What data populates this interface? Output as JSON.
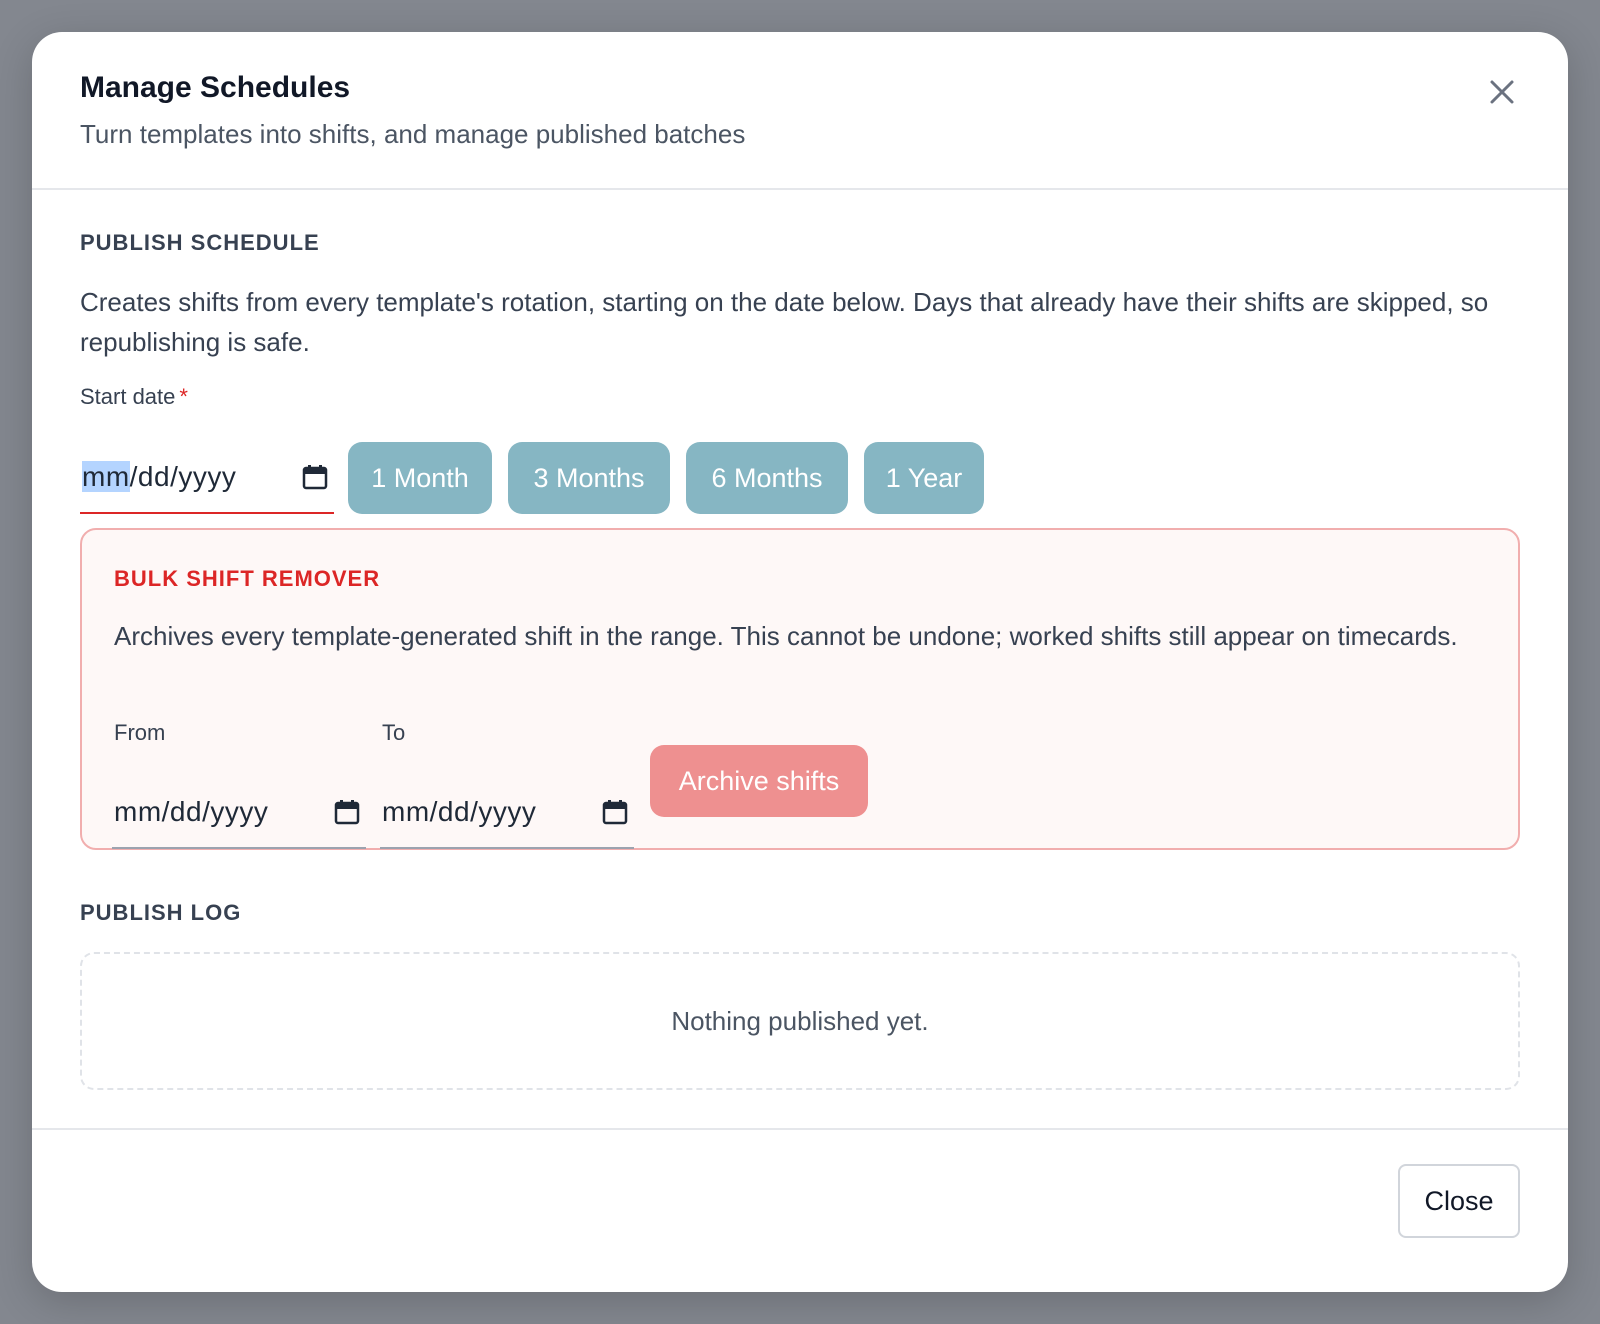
{
  "modal": {
    "title": "Manage Schedules",
    "subtitle": "Turn templates into shifts, and manage published batches",
    "close_icon": "close-icon"
  },
  "publish": {
    "title": "PUBLISH SCHEDULE",
    "description": "Creates shifts from every template's rotation, starting on the date below. Days that already have their shifts are skipped, so republishing is safe.",
    "start_label": "Start date",
    "required_mark": "*",
    "start_placeholder_month": "mm",
    "start_placeholder_rest": "/dd/yyyy",
    "ranges": [
      "1 Month",
      "3 Months",
      "6 Months",
      "1 Year"
    ]
  },
  "bulk": {
    "title": "BULK SHIFT REMOVER",
    "description": "Archives every template-generated shift in the range. This cannot be undone; worked shifts still appear on timecards.",
    "from_label": "From",
    "to_label": "To",
    "from_placeholder": "mm/dd/yyyy",
    "to_placeholder": "mm/dd/yyyy",
    "archive_label": "Archive shifts",
    "accent_color": "#dc2626"
  },
  "log": {
    "title": "PUBLISH LOG",
    "empty_text": "Nothing published yet."
  },
  "footer": {
    "close_label": "Close"
  },
  "colors": {
    "chip": "#86b6c3",
    "archive": "#ee9090",
    "danger": "#dc2626"
  }
}
